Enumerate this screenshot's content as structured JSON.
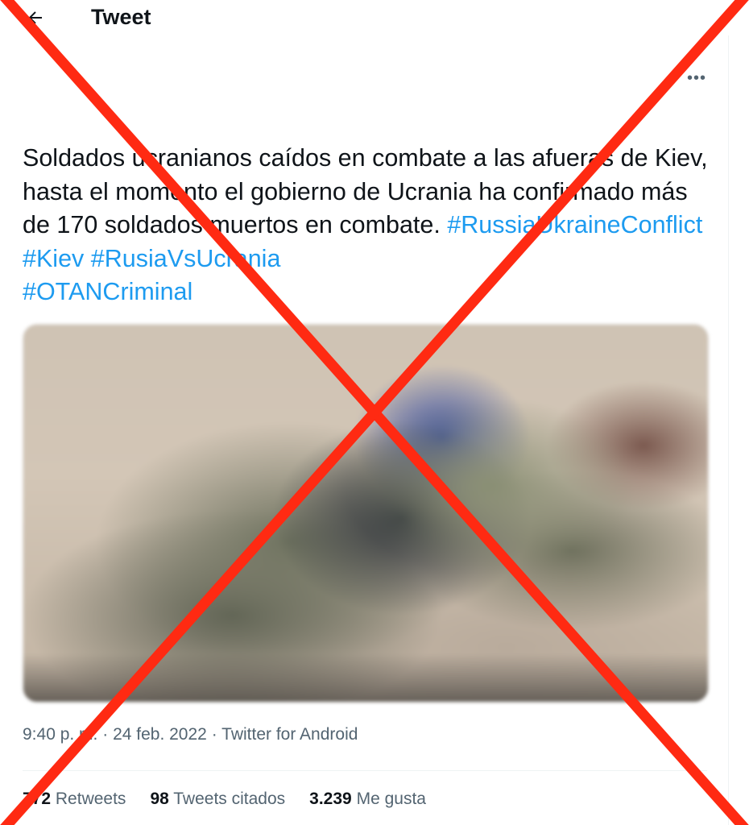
{
  "header": {
    "back_icon": "arrow-left-icon",
    "title": "Tweet"
  },
  "tweet": {
    "more_icon": "more-horizontal-icon",
    "more_label": "•••",
    "text_line1": "Soldados ucranianos caídos en combate a las afueras de Kiev, hasta el momento el gobierno de Ucrania ha confirmado más de 170 soldados muertos en combate.",
    "hashtags": [
      "#RussiaUkraineConflict",
      "#Kiev",
      "#RusiaVsUcrania",
      "#OTANCriminal"
    ],
    "media": {
      "description_icon": "blurred-photo"
    },
    "time": "9:40 p. m.",
    "separator": "·",
    "date": "24 feb. 2022",
    "source": "Twitter for Android"
  },
  "stats": [
    {
      "count": "772",
      "label": "Retweets"
    },
    {
      "count": "98",
      "label": "Tweets citados"
    },
    {
      "count": "3.239",
      "label": "Me gusta"
    }
  ],
  "colors": {
    "accent": "#1d9bf0",
    "text": "#0f1419",
    "secondary": "#536471",
    "cross": "#ff2a12"
  },
  "overlay": {
    "icon": "red-x-cross-icon"
  }
}
